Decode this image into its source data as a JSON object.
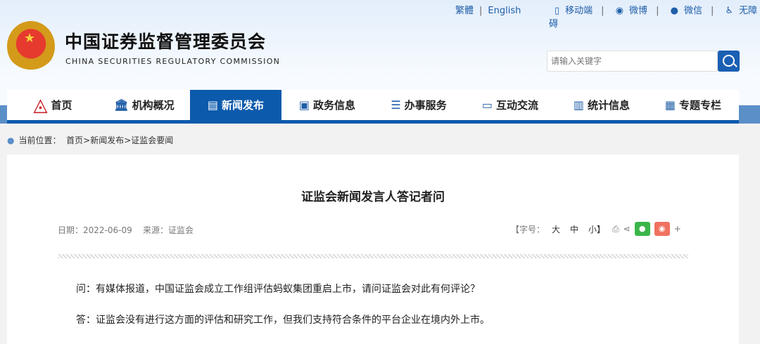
{
  "top_links": {
    "traditional": "繁體",
    "english": "English",
    "mobile": "移动端",
    "weibo": "微博",
    "wechat": "微信",
    "accessibility": "无障碍"
  },
  "header": {
    "title_cn": "中国证券监督管理委员会",
    "title_en": "CHINA SECURITIES REGULATORY COMMISSION",
    "search_placeholder": "请输入关键字"
  },
  "nav": [
    "首页",
    "机构概况",
    "新闻发布",
    "政务信息",
    "办事服务",
    "互动交流",
    "统计信息",
    "专题专栏"
  ],
  "breadcrumb": {
    "label": "当前位置：",
    "path": "首页>新闻发布>证监会要闻"
  },
  "article": {
    "title": "证监会新闻发言人答记者问",
    "date": "日期：2022-06-09",
    "source": "来源：证监会",
    "font_label": "【字号：",
    "font_large": "大",
    "font_medium": "中",
    "font_small": "小】",
    "plus": "+",
    "paragraphs": [
      "问：有媒体报道，中国证监会成立工作组评估蚂蚁集团重启上市，请问证监会对此有何评论？",
      "答：证监会没有进行这方面的评估和研究工作，但我们支持符合条件的平台企业在境内外上市。"
    ]
  }
}
